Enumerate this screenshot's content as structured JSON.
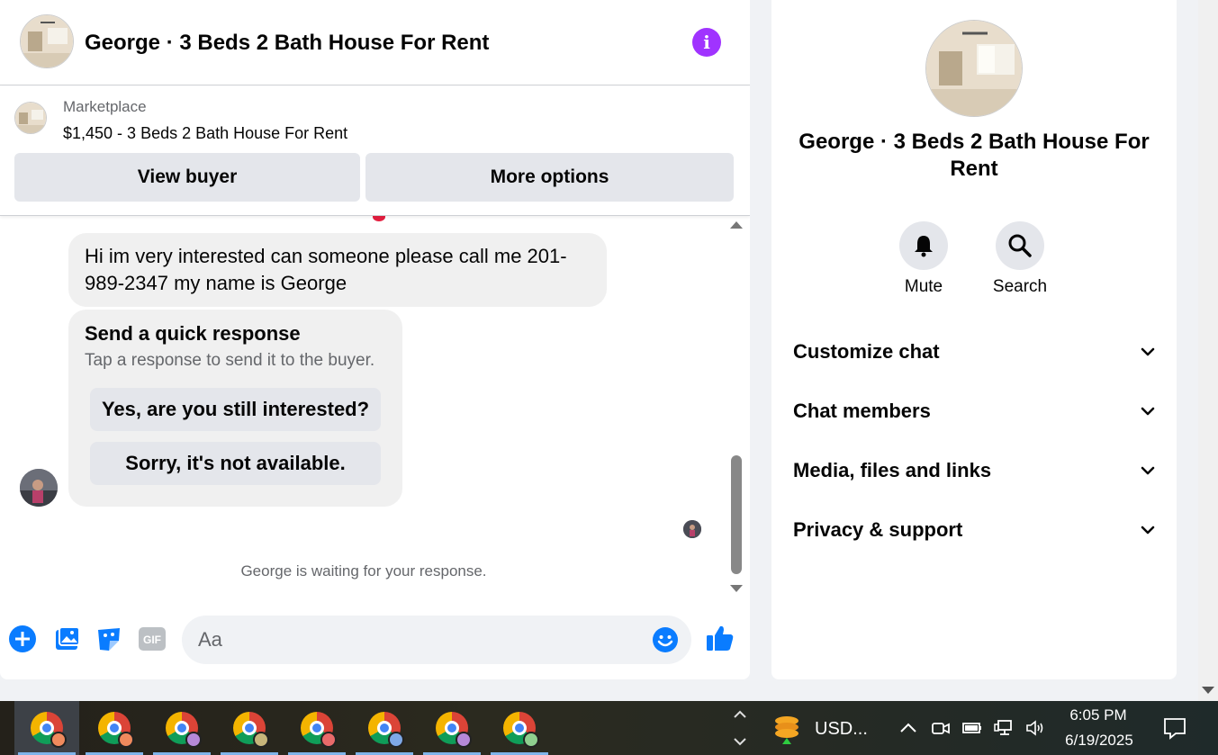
{
  "header": {
    "title": "George · 3 Beds 2 Bath House For Rent",
    "info_label": "i"
  },
  "listing": {
    "source": "Marketplace",
    "title": "$1,450 - 3 Beds 2 Bath House For Rent",
    "view_buyer_label": "View buyer",
    "more_options_label": "More options"
  },
  "messages": {
    "incoming_text": "Hi im very interested can someone please call me 201-989-2347 my name is George",
    "quick_response": {
      "title": "Send a quick response",
      "subtitle": "Tap a response to send it to the buyer.",
      "options": [
        "Yes, are you still interested?",
        "Sorry, it's not available."
      ]
    },
    "waiting_text": "George is waiting for your response."
  },
  "composer": {
    "placeholder": "Aa",
    "gif_label": "GIF"
  },
  "info_panel": {
    "title": "George · 3 Beds 2 Bath House For Rent",
    "actions": [
      {
        "label": "Mute",
        "icon": "bell-icon"
      },
      {
        "label": "Search",
        "icon": "search-icon"
      }
    ],
    "sections": [
      "Customize chat",
      "Chat members",
      "Media, files and links",
      "Privacy & support"
    ]
  },
  "taskbar": {
    "apps": [
      {
        "icon": "chrome-icon",
        "profile_color": "#f08a5d",
        "active": true
      },
      {
        "icon": "chrome-icon",
        "profile_color": "#f08a5d",
        "active": false
      },
      {
        "icon": "chrome-icon",
        "profile_color": "#b689d8",
        "active": false
      },
      {
        "icon": "chrome-icon",
        "profile_color": "#c7b57a",
        "active": false
      },
      {
        "icon": "chrome-icon",
        "profile_color": "#e86a6a",
        "active": false
      },
      {
        "icon": "chrome-icon",
        "profile_color": "#7ea8e6",
        "active": false
      },
      {
        "icon": "chrome-icon",
        "profile_color": "#b689d8",
        "active": false
      },
      {
        "icon": "chrome-icon",
        "profile_color": "#8fcf8f",
        "active": false
      }
    ],
    "currency_label": "USD...",
    "time": "6:05 PM",
    "date": "6/19/2025"
  },
  "colors": {
    "accent_blue": "#0a7cff",
    "info_purple": "#a033ff",
    "panel_bg": "#f0f2f5"
  }
}
